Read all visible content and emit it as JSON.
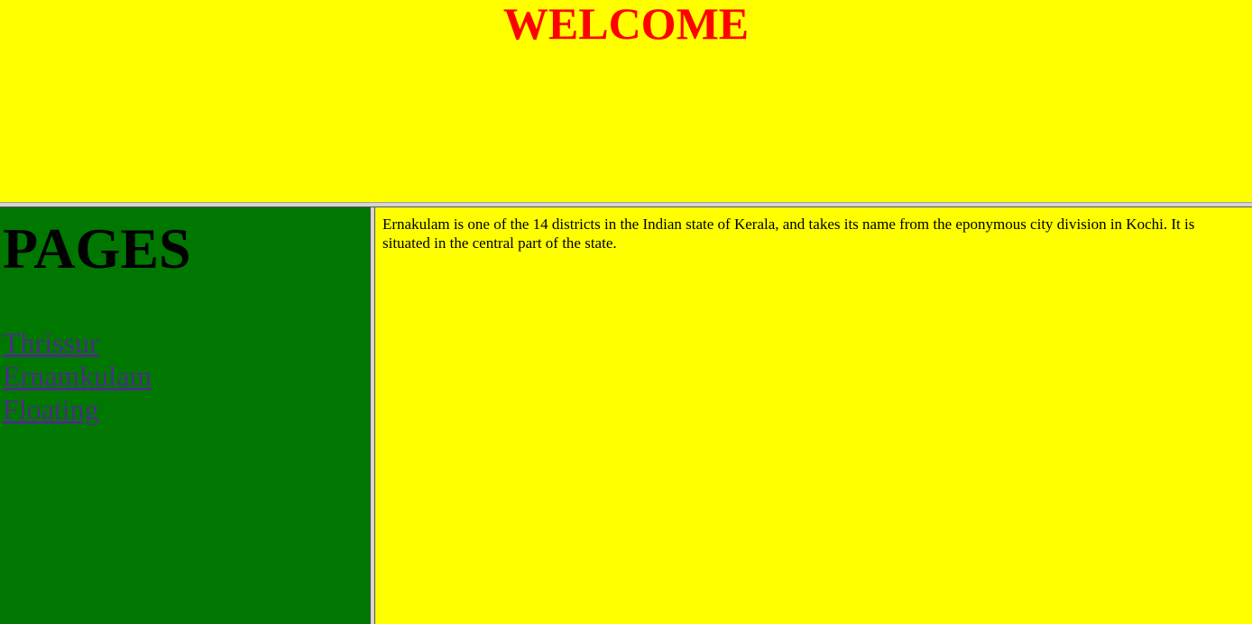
{
  "colors": {
    "top_bg": "#ffff00",
    "title_color": "#ff0000",
    "left_bg": "#007700",
    "right_bg": "#ffff00",
    "link_color": "#4b2e83"
  },
  "header": {
    "title": "WELCOME"
  },
  "sidebar": {
    "heading": "PAGES",
    "links": [
      {
        "label": "Thrissur"
      },
      {
        "label": "Ernamkulam"
      },
      {
        "label": "Floating"
      }
    ]
  },
  "main": {
    "paragraph": "Ernakulam is one of the 14 districts in the Indian state of Kerala, and takes its name from the eponymous city division in Kochi. It is situated in the central part of the state."
  }
}
